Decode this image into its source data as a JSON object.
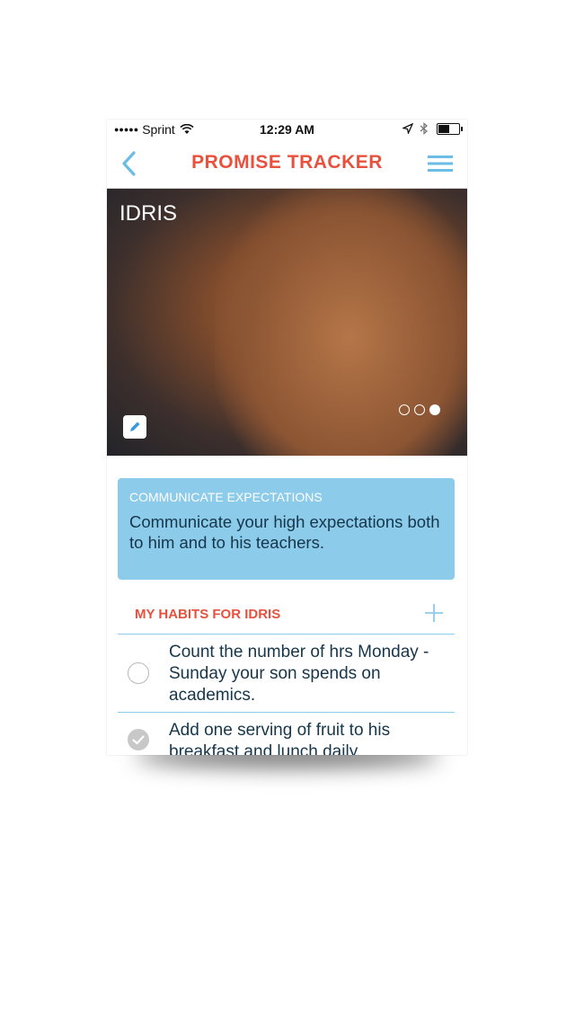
{
  "status_bar": {
    "signal_dots": "●●●●●",
    "carrier": "Sprint",
    "time": "12:29 AM"
  },
  "nav": {
    "logo_text": "PROMISE TRACKER",
    "back_icon": "chevron-left-icon",
    "menu_icon": "hamburger-menu-icon"
  },
  "hero": {
    "name": "IDRIS",
    "edit_icon": "pencil-icon",
    "pages": 3,
    "active_page": 3
  },
  "card": {
    "title": "COMMUNICATE EXPECTATIONS",
    "body": "Communicate your high expectations both to him and to his teachers."
  },
  "habits": {
    "title": "MY HABITS FOR IDRIS",
    "items": [
      {
        "text": "Count the number of hrs Monday - Sunday your son spends on academics.",
        "checked": false
      },
      {
        "text": "Add one serving of fruit to his breakfast and lunch daily.",
        "checked": true
      }
    ]
  },
  "colors": {
    "accent_red": "#e8513d",
    "accent_blue": "#8ccbea",
    "text_dark": "#16364a"
  }
}
